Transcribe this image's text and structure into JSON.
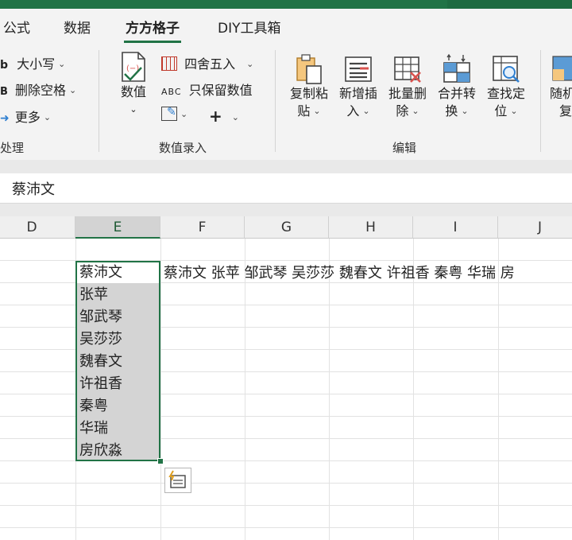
{
  "menu": {
    "tabs": [
      {
        "label": "公式",
        "active": false
      },
      {
        "label": "数据",
        "active": false
      },
      {
        "label": "方方格子",
        "active": true
      },
      {
        "label": "DIY工具箱",
        "active": false
      }
    ]
  },
  "ribbon": {
    "text_group": {
      "case_label": "大小写",
      "delete_space_label": "删除空格",
      "more_label": "更多",
      "group_label": "处理"
    },
    "numeric_group": {
      "value_label": "数值",
      "round_label": "四舍五入",
      "keep_numbers_label": "只保留数值",
      "plus_label": "+",
      "group_label": "数值录入"
    },
    "edit_group": {
      "buttons": [
        {
          "line1": "复制粘",
          "line2": "贴"
        },
        {
          "line1": "新增插",
          "line2": "入"
        },
        {
          "line1": "批量删",
          "line2": "除"
        },
        {
          "line1": "合并转",
          "line2": "换"
        },
        {
          "line1": "查找定",
          "line2": "位"
        }
      ],
      "partial_button": {
        "line1": "随机",
        "line2": "复"
      },
      "group_label": "编辑"
    }
  },
  "formula_bar": {
    "value": "蔡沛文"
  },
  "columns": [
    "D",
    "E",
    "F",
    "G",
    "H",
    "I",
    "J"
  ],
  "selected_column": "E",
  "column_e_values": [
    "蔡沛文",
    "张苹",
    "邹武琴",
    "吴莎莎",
    "魏春文",
    "许祖香",
    "秦粤",
    "华瑞",
    "房欣淼"
  ],
  "row_text": "蔡沛文 张苹 邹武琴 吴莎莎 魏春文 许祖香 秦粤 华瑞 房",
  "colors": {
    "accent": "#217346",
    "selection": "#d4d4d4",
    "ribbon_bg": "#f3f3f3"
  }
}
